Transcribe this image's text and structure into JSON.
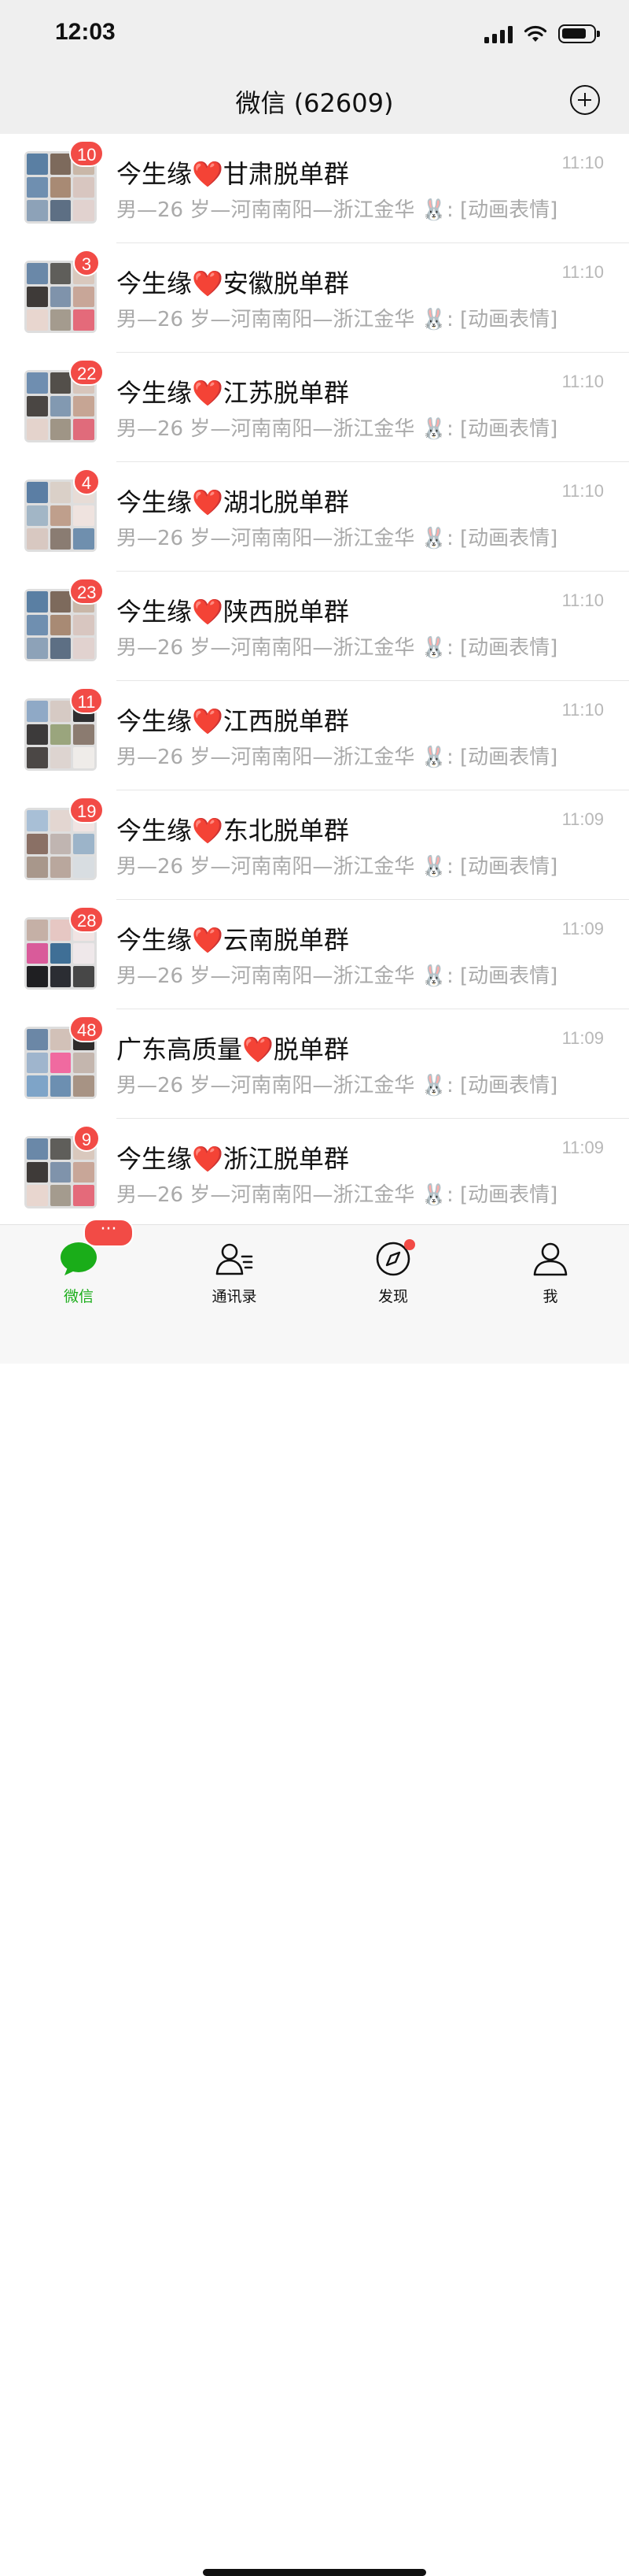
{
  "status_bar": {
    "time": "12:03"
  },
  "header": {
    "title": "微信 (62609)"
  },
  "chats": [
    {
      "prefix": "今生缘",
      "heart": "❤️",
      "suffix": "甘肃脱单群",
      "preview": "男—26 岁—河南南阳—浙江金华 🐰: [动画表情]",
      "time": "11:10",
      "badge": "10",
      "tiles": [
        "#5a7fa3",
        "#7d6a5c",
        "#c9b7a8",
        "#6f8fb0",
        "#a88a74",
        "#d8c6c0",
        "#8da2b8",
        "#5d6f84",
        "#e1d2cf"
      ]
    },
    {
      "prefix": "今生缘",
      "heart": "❤️",
      "suffix": "安徽脱单群",
      "preview": "男—26 岁—河南南阳—浙江金华 🐰: [动画表情]",
      "time": "11:10",
      "badge": "3",
      "tiles": [
        "#6a88a8",
        "#5f5e5a",
        "#d9c8bd",
        "#3e3a38",
        "#7f93ab",
        "#c8a698",
        "#e8d6cf",
        "#a49b8e",
        "#e46a7a"
      ]
    },
    {
      "prefix": "今生缘",
      "heart": "❤️",
      "suffix": "江苏脱单群",
      "preview": "男—26 岁—河南南阳—浙江金华 🐰: [动画表情]",
      "time": "11:10",
      "badge": "22",
      "tiles": [
        "#6f8eb0",
        "#534f4a",
        "#d7c5bb",
        "#4a4643",
        "#8299b1",
        "#c6a594",
        "#e4d3cc",
        "#9f9586",
        "#e06b7b"
      ]
    },
    {
      "prefix": "今生缘",
      "heart": "❤️",
      "suffix": "湖北脱单群",
      "preview": "男—26 岁—河南南阳—浙江金华 🐰: [动画表情]",
      "time": "11:10",
      "badge": "4",
      "tiles": [
        "#5b7ea4",
        "#dad0c8",
        "#e7dcd6",
        "#a2b6c6",
        "#bf9f8c",
        "#efe3df",
        "#d8c8c1",
        "#8a7c72",
        "#6f8fae"
      ]
    },
    {
      "prefix": "今生缘",
      "heart": "❤️",
      "suffix": "陕西脱单群",
      "preview": "男—26 岁—河南南阳—浙江金华 🐰: [动画表情]",
      "time": "11:10",
      "badge": "23",
      "tiles": [
        "#5a7fa3",
        "#7d6a5c",
        "#c9b7a8",
        "#6f8fb0",
        "#a88a74",
        "#d8c6c0",
        "#8da2b8",
        "#5d6f84",
        "#e1d2cf"
      ]
    },
    {
      "prefix": "今生缘",
      "heart": "❤️",
      "suffix": "江西脱单群",
      "preview": "男—26 岁—河南南阳—浙江金华 🐰: [动画表情]",
      "time": "11:10",
      "badge": "11",
      "tiles": [
        "#8fa9c6",
        "#d6cac4",
        "#2f2f31",
        "#3c3a3a",
        "#9aa57d",
        "#8b7b70",
        "#4b4745",
        "#ddd4d0",
        "#efece9"
      ]
    },
    {
      "prefix": "今生缘",
      "heart": "❤️",
      "suffix": "东北脱单群",
      "preview": "男—26 岁—河南南阳—浙江金华 🐰: [动画表情]",
      "time": "11:09",
      "badge": "19",
      "tiles": [
        "#a8bfd6",
        "#e3d6d1",
        "#f0e4e2",
        "#8a7065",
        "#c0b5b1",
        "#9cb4c9",
        "#a8978b",
        "#b9a79d",
        "#d8dde1"
      ]
    },
    {
      "prefix": "今生缘",
      "heart": "❤️",
      "suffix": "云南脱单群",
      "preview": "男—26 岁—河南南阳—浙江金华 🐰: [动画表情]",
      "time": "11:09",
      "badge": "28",
      "tiles": [
        "#c5b0a6",
        "#e6c7c3",
        "#f1e4e3",
        "#d95b9a",
        "#3f6f96",
        "#efe8ea",
        "#1f1f22",
        "#2b2d33",
        "#474747"
      ]
    },
    {
      "prefix": "广东高质量",
      "heart": "❤️",
      "suffix": "脱单群",
      "preview": "男—26 岁—河南南阳—浙江金华 🐰: [动画表情]",
      "time": "11:09",
      "badge": "48",
      "tiles": [
        "#6b87a6",
        "#d2c1b8",
        "#2f2c2b",
        "#9fb5cd",
        "#f06aa0",
        "#c4b6ae",
        "#7ea4c8",
        "#6c8fb1",
        "#a79384"
      ]
    },
    {
      "prefix": "今生缘",
      "heart": "❤️",
      "suffix": "浙江脱单群",
      "preview": "男—26 岁—河南南阳—浙江金华 🐰: [动画表情]",
      "time": "11:09",
      "badge": "9",
      "tiles": [
        "#6a88a8",
        "#5f5e5a",
        "#d9c8bd",
        "#3e3a38",
        "#7f93ab",
        "#c8a698",
        "#e8d6cf",
        "#a49b8e",
        "#e46a7a"
      ]
    }
  ],
  "tabbar": {
    "chats_label": "微信",
    "chats_badge": "···",
    "contacts_label": "通讯录",
    "discover_label": "发现",
    "me_label": "我"
  },
  "colors": {
    "accent_green": "#1aad19",
    "badge_red": "#f24b46",
    "heart_red": "#e8202a"
  }
}
